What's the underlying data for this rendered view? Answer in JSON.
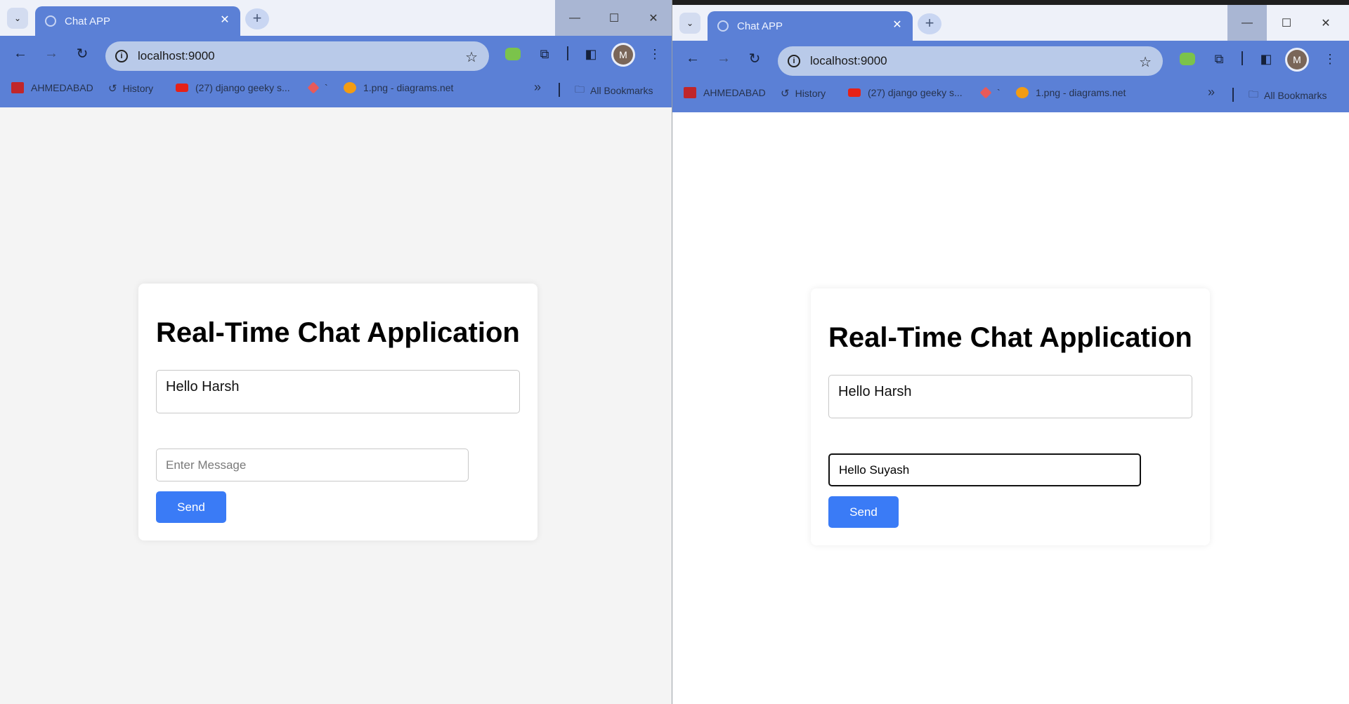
{
  "windows": [
    {
      "tab": {
        "title": "Chat APP"
      },
      "address": {
        "url": "localhost:9000"
      },
      "profile": {
        "initial": "M"
      },
      "bookmarks": {
        "items": [
          "AHMEDABAD",
          "History",
          "(27) django geeky s...",
          "`",
          "1.png - diagrams.net"
        ],
        "more": "»",
        "all": "All Bookmarks"
      },
      "page": {
        "heading": "Real-Time Chat Application",
        "chat_text": "Hello Harsh",
        "message_placeholder": "Enter Message",
        "message_value": "",
        "send_label": "Send"
      }
    },
    {
      "tab": {
        "title": "Chat APP"
      },
      "address": {
        "url": "localhost:9000"
      },
      "profile": {
        "initial": "M"
      },
      "bookmarks": {
        "items": [
          "AHMEDABAD",
          "History",
          "(27) django geeky s...",
          "`",
          "1.png - diagrams.net"
        ],
        "more": "»",
        "all": "All Bookmarks"
      },
      "page": {
        "heading": "Real-Time Chat Application",
        "chat_text": "Hello Harsh",
        "message_placeholder": "Enter Message",
        "message_value": "Hello Suyash",
        "send_label": "Send"
      }
    }
  ],
  "colors": {
    "chrome_accent": "#5b80d6",
    "send_button": "#3a7bf6",
    "page_bg_left": "#f4f4f4",
    "page_bg_right": "#ffffff"
  },
  "icons": [
    "tab-list-icon",
    "globe-icon",
    "close-icon",
    "plus-icon",
    "minimize-icon",
    "maximize-icon",
    "back-arrow-icon",
    "forward-arrow-icon",
    "reload-icon",
    "info-icon",
    "star-icon",
    "frog-extension-icon",
    "puzzle-extensions-icon",
    "sidebar-icon",
    "kebab-menu-icon",
    "history-icon",
    "youtube-icon",
    "folder-icon"
  ]
}
